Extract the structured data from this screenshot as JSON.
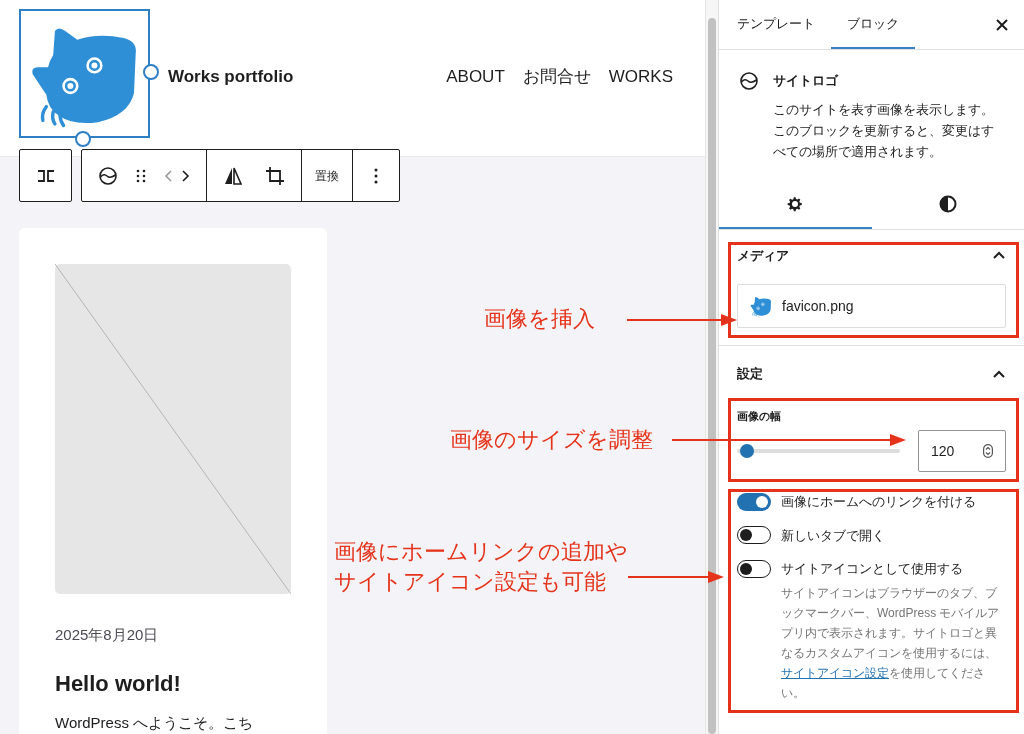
{
  "site_header": {
    "title": "Works portfolio",
    "nav": [
      "ABOUT",
      "お問合せ",
      "WORKS"
    ]
  },
  "block_toolbar": {
    "replace": "置換"
  },
  "post": {
    "date": "2025年8月20日",
    "title": "Hello world!",
    "excerpt": "WordPress へようこそ。こち"
  },
  "sidebar": {
    "tabs": [
      {
        "label": "テンプレート",
        "selected": false
      },
      {
        "label": "ブロック",
        "selected": true
      }
    ],
    "block": {
      "name": "サイトロゴ",
      "description": "このサイトを表す画像を表示します。このブロックを更新すると、変更はすべての場所で適用されます。"
    },
    "inspector_tabs": [
      {
        "kind": "settings",
        "selected": true
      },
      {
        "kind": "styles",
        "selected": false
      }
    ],
    "media": {
      "title": "メディア",
      "expanded": true,
      "file": "favicon.png"
    },
    "settings": {
      "title": "設定",
      "expanded": true,
      "width_label": "画像の幅",
      "level": 0.06,
      "width_value": "120",
      "toggles": [
        {
          "label": "画像にホームへのリンクを付ける",
          "on": true
        },
        {
          "label": "新しいタブで開く",
          "on": false
        },
        {
          "label": "サイトアイコンとして使用する",
          "on": false
        }
      ],
      "help_before": "サイトアイコンはブラウザーのタブ、ブックマークバー、WordPress モバイルアプリ内で表示されます。サイトロゴと異なるカスタムアイコンを使用するには、",
      "help_link": "サイトアイコン設定",
      "help_after": "を使用してください。"
    }
  },
  "annotations": [
    {
      "lines": [
        "画像を挿入"
      ]
    },
    {
      "lines": [
        "画像のサイズを調整"
      ]
    },
    {
      "lines": [
        "画像にホームリンクの追加や",
        "サイトアイコン設定も可能"
      ]
    }
  ]
}
